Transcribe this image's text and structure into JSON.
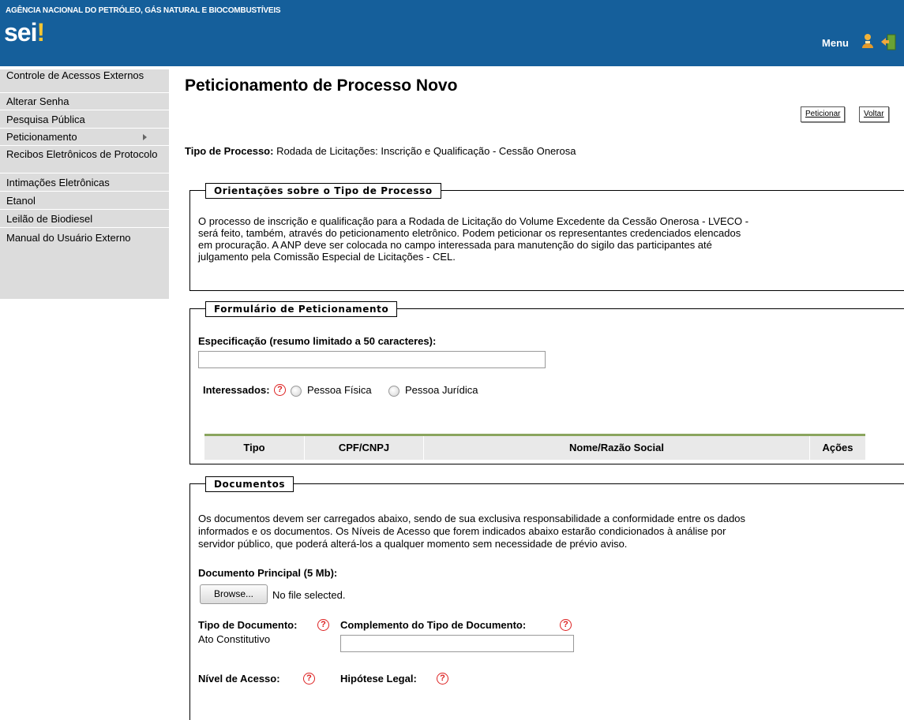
{
  "header": {
    "org_name": "AGÊNCIA NACIONAL DO PETRÓLEO, GÁS NATURAL E BIOCOMBUSTÍVEIS",
    "logo_text": "sei",
    "logo_mark": "!",
    "menu_label": "Menu",
    "user_icon": "user-icon",
    "exit_icon": "exit-door-icon",
    "bar_color": "#155f9b"
  },
  "sidebar": {
    "items": [
      {
        "label": "Controle de Acessos Externos"
      },
      {
        "label": "Alterar Senha"
      },
      {
        "label": "Pesquisa Pública"
      },
      {
        "label": "Peticionamento"
      },
      {
        "label": "Recibos Eletrônicos de Protocolo"
      },
      {
        "label": "Intimações Eletrônicas"
      },
      {
        "label": "Etanol"
      },
      {
        "label": "Leilão de Biodiesel"
      },
      {
        "label": "Manual do Usuário Externo"
      }
    ]
  },
  "main": {
    "title": "Peticionamento de Processo Novo",
    "buttons": {
      "peticionar": "Peticionar",
      "voltar": "Voltar"
    },
    "tipo_label": "Tipo de Processo:",
    "tipo_value": "Rodada de Licitações: Inscrição e Qualificação - Cessão Onerosa",
    "orientacoes": {
      "legend": "Orientações sobre o Tipo de Processo",
      "lines": [
        "O processo de inscrição e qualificação para a Rodada de Licitação do Volume Excedente da Cessão Onerosa - LVECO -",
        "será feito, também, através do peticionamento eletrônico. Podem peticionar os representantes credenciados elencados",
        "em procuração. A ANP deve ser colocada no campo interessada para manutenção do sigilo das participantes até",
        "julgamento pela Comissão Especial de Licitações - CEL."
      ]
    },
    "formulario": {
      "legend": "Formulário de Peticionamento",
      "especificacao_label": "Especificação (resumo limitado a 50 caracteres):",
      "especificacao_value": "",
      "interessados_label": "Interessados:",
      "radio_fisica": "Pessoa Física",
      "radio_juridica": "Pessoa Jurídica",
      "table_headers": [
        "Tipo",
        "CPF/CNPJ",
        "Nome/Razão Social",
        "Ações"
      ]
    },
    "documentos": {
      "legend": "Documentos",
      "lines": [
        "Os documentos devem ser carregados abaixo, sendo de sua exclusiva responsabilidade a conformidade entre os dados",
        "informados e os documentos. Os Níveis de Acesso que forem indicados abaixo estarão condicionados à análise por",
        "servidor público, que poderá alterá-los a qualquer momento sem necessidade de prévio aviso."
      ],
      "principal_label": "Documento Principal (5 Mb):",
      "browse_label": "Browse...",
      "file_status": "No file selected.",
      "tipo_doc_label": "Tipo de Documento:",
      "tipo_doc_value": "Ato Constitutivo",
      "complemento_label": "Complemento do Tipo de Documento:",
      "nivel_label": "Nível de Acesso:",
      "hipotese_label": "Hipótese Legal:"
    }
  }
}
